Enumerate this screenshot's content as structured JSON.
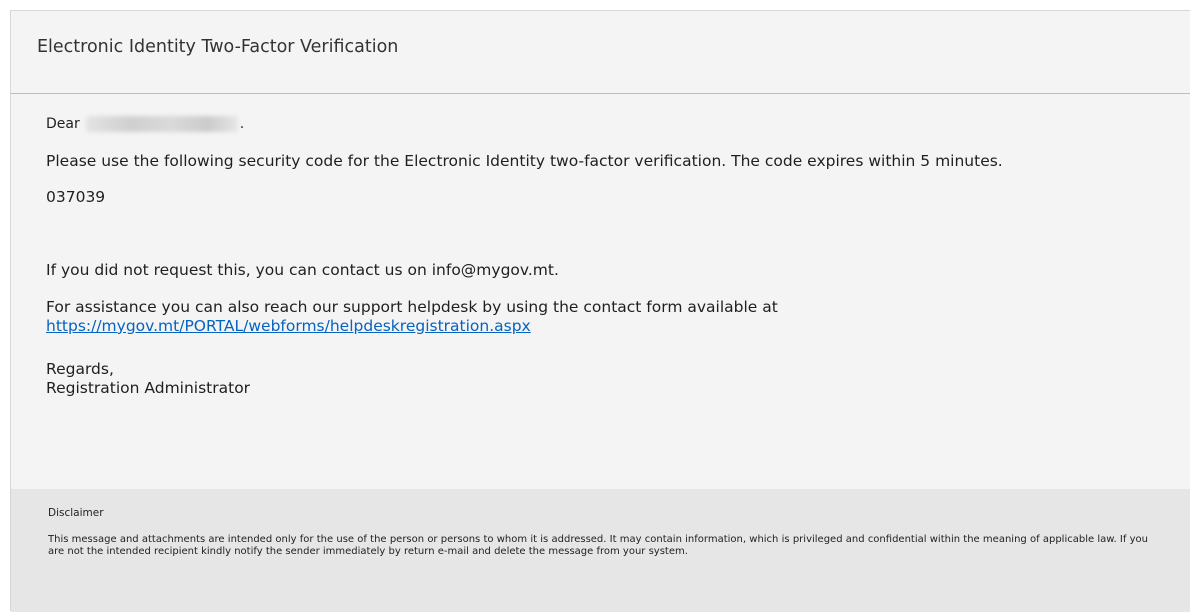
{
  "email": {
    "title": "Electronic Identity Two-Factor Verification",
    "greeting": "Dear",
    "greeting_suffix": ".",
    "instruction": "Please use the following security code for the Electronic Identity two-factor verification. The code expires within 5 minutes.",
    "security_code": "037039",
    "contact_text": "If you did not request this, you can contact us on info@mygov.mt.",
    "assist_text": "For assistance you can also reach our support helpdesk by using the contact form available at",
    "helpdesk_url": "https://mygov.mt/PORTAL/webforms/helpdeskregistration.aspx",
    "closing": "Regards,",
    "signature": "Registration Administrator"
  },
  "disclaimer": {
    "title": "Disclaimer",
    "text": "This message and attachments are intended only for the use of the person or persons to whom it is addressed. It may contain information, which is privileged and confidential within the meaning of applicable law. If you are not the intended recipient kindly notify the sender immediately by return e-mail and delete the message from your system."
  },
  "colors": {
    "background": "#f4f4f4",
    "disclaimer_background": "#e6e6e6",
    "link": "#0563c1"
  }
}
